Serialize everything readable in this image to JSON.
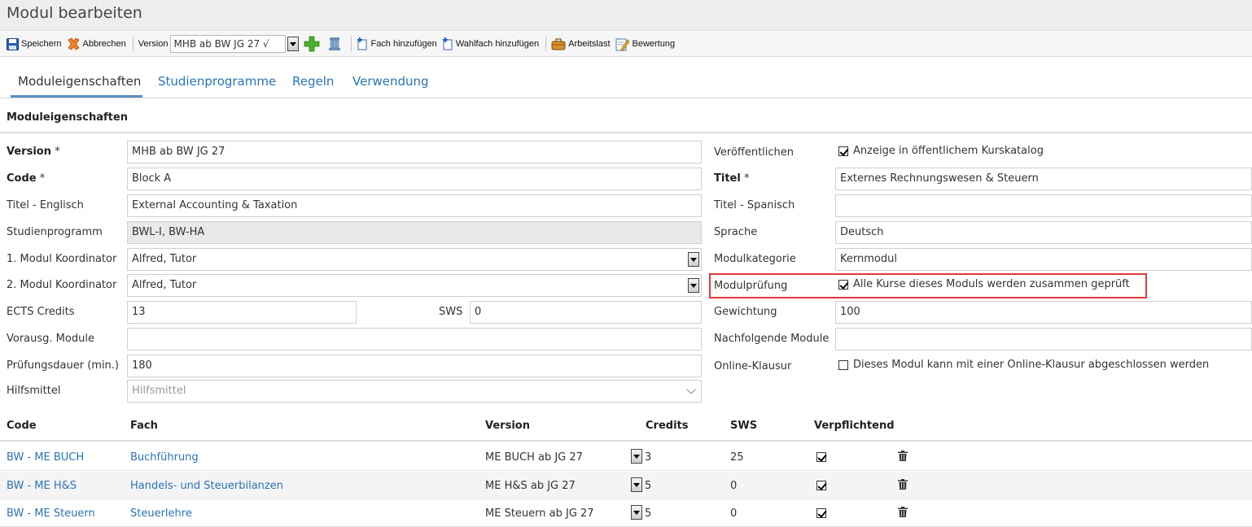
{
  "window": {
    "title": "Modul bearbeiten"
  },
  "toolbar": {
    "save_label": "Speichern",
    "cancel_label": "Abbrechen",
    "version_label": "Version",
    "version_value": "MHB ab BW JG 27 √",
    "add_subject_label": "Fach hinzufügen",
    "add_elective_label": "Wahlfach hinzufügen",
    "workload_label": "Arbeitslast",
    "rating_label": "Bewertung"
  },
  "tabs": [
    {
      "label": "Moduleigenschaften",
      "active": true
    },
    {
      "label": "Studienprogramme",
      "active": false
    },
    {
      "label": "Regeln",
      "active": false
    },
    {
      "label": "Verwendung",
      "active": false
    }
  ],
  "section": {
    "title": "Moduleigenschaften"
  },
  "form": {
    "version": {
      "label": "Version",
      "required": "*",
      "value": "MHB ab BW JG 27"
    },
    "code": {
      "label": "Code",
      "required": "*",
      "value": "Block A"
    },
    "title_en": {
      "label": "Titel - Englisch",
      "value": "External Accounting & Taxation"
    },
    "programs": {
      "label": "Studienprogramm",
      "value": "BWL-I, BW-HA"
    },
    "coordinator1": {
      "label": "1. Modul Koordinator",
      "value": "Alfred, Tutor"
    },
    "coordinator2": {
      "label": "2. Modul Koordinator",
      "value": "Alfred, Tutor"
    },
    "ects": {
      "label": "ECTS Credits",
      "value": "13"
    },
    "sws": {
      "label": "SWS",
      "value": "0"
    },
    "prereq": {
      "label": "Vorausg. Module",
      "value": ""
    },
    "exam_duration": {
      "label": "Prüfungsdauer (min.)",
      "value": "180"
    },
    "aids": {
      "label": "Hilfsmittel",
      "placeholder": "Hilfsmittel"
    },
    "publish": {
      "label": "Veröffentlichen",
      "checkbox_label": "Anzeige in öffentlichem Kurskatalog",
      "checked": true
    },
    "title": {
      "label": "Titel",
      "required": "*",
      "value": "Externes  Rechnungswesen & Steuern"
    },
    "title_es": {
      "label": "Titel - Spanisch",
      "value": ""
    },
    "language": {
      "label": "Sprache",
      "value": "Deutsch"
    },
    "category": {
      "label": "Modulkategorie",
      "value": "Kernmodul"
    },
    "exam": {
      "label": "Modulprüfung",
      "checkbox_label": "Alle Kurse dieses Moduls werden zusammen geprüft",
      "checked": true
    },
    "weighting": {
      "label": "Gewichtung",
      "value": "100"
    },
    "successor": {
      "label": "Nachfolgende Module",
      "value": ""
    },
    "online_exam": {
      "label": "Online-Klausur",
      "checkbox_label": "Dieses Modul kann mit einer Online-Klausur abgeschlossen werden",
      "checked": false
    }
  },
  "table": {
    "columns": [
      "Code",
      "Fach",
      "Version",
      "Credits",
      "SWS",
      "Verpflichtend"
    ],
    "rows": [
      {
        "code": "BW - ME BUCH",
        "subject": "Buchführung",
        "version": "ME BUCH ab JG 27",
        "credits": "3",
        "sws": "25",
        "mandatory": true
      },
      {
        "code": "BW - ME H&S",
        "subject": "Handels- und Steuerbilanzen",
        "version": "ME H&S ab JG 27",
        "credits": "5",
        "sws": "0",
        "mandatory": true
      },
      {
        "code": "BW - ME Steuern",
        "subject": "Steuerlehre",
        "version": "ME Steuern ab JG 27",
        "credits": "5",
        "sws": "0",
        "mandatory": true
      }
    ]
  },
  "colors": {
    "link": "#2a74b6",
    "highlight": "#e03a3a",
    "tab_underline": "#5b8fc2"
  }
}
